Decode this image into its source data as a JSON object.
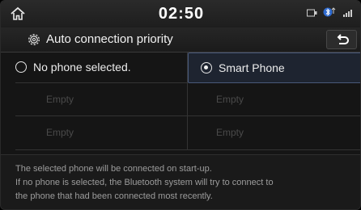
{
  "status_bar": {
    "time": "02:50",
    "icons": [
      "home-icon",
      "media-status-icon",
      "bluetooth-status-icon",
      "signal-status-icon"
    ]
  },
  "header": {
    "title": "Auto connection priority",
    "icon": "gear-icon",
    "back_icon": "back-arrow-icon"
  },
  "options": [
    {
      "label": "No phone selected.",
      "selected": false
    },
    {
      "label": "Smart Phone",
      "selected": true
    }
  ],
  "slots": [
    "Empty",
    "Empty",
    "Empty",
    "Empty"
  ],
  "description": [
    "The selected phone will be connected on start-up.",
    "If no phone is selected, the Bluetooth system will try to connect to",
    "the phone that had been connected most recently."
  ],
  "colors": {
    "selected_bg": "#1e2430",
    "selected_border": "#49597a",
    "empty_text": "#4a4a4a"
  }
}
